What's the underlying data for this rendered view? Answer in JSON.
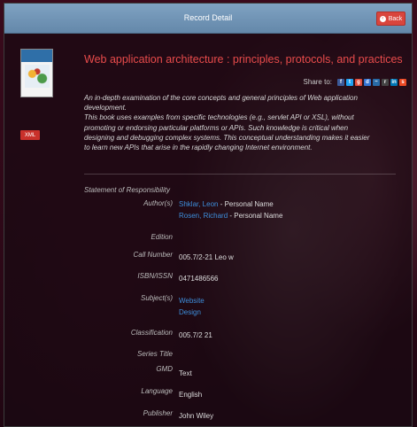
{
  "header": {
    "title": "Record Detail",
    "back_label": "Back"
  },
  "record": {
    "title": "Web application architecture : principles, protocols, and practices",
    "xml_label": "XML",
    "cover_alt": "Web Application Architecture",
    "share_label": "Share to:",
    "share_icons": [
      "facebook-icon",
      "twitter-icon",
      "google-plus-icon",
      "delicious-icon",
      "digg-icon",
      "reddit-icon",
      "linkedin-icon",
      "stumbleupon-icon"
    ],
    "description_lines": [
      "An in-depth examination of the core concepts and general principles of Web application",
      "development.",
      "This book uses examples from specific technologies (e.g., servlet API or XSL), without",
      "promoting or endorsing particular platforms or APIs. Such knowledge is critical when",
      "designing and debugging complex systems. This conceptual understanding makes it easier",
      "to learn new APIs that arise in the rapidly changing Internet environment."
    ]
  },
  "details": {
    "section_label": "Statement of Responsibility",
    "authors_label": "Author(s)",
    "authors": [
      {
        "name": "Shklar, Leon",
        "role": " - Personal Name"
      },
      {
        "name": "Rosen, Richard",
        "role": " - Personal Name"
      }
    ],
    "edition_label": "Edition",
    "edition": "",
    "call_number_label": "Call Number",
    "call_number": "005.7/2-21 Leo w",
    "isbn_label": "ISBN/ISSN",
    "isbn": "0471486566",
    "subjects_label": "Subject(s)",
    "subjects": [
      "Website",
      "Design"
    ],
    "classification_label": "Classification",
    "classification": "005.7/2 21",
    "series_label": "Series Title",
    "series": "",
    "gmd_label": "GMD",
    "gmd": "Text",
    "language_label": "Language",
    "language": "English",
    "publisher_label": "Publisher",
    "publisher": "John Wiley"
  },
  "colors": {
    "header_bg": "#6f93b6",
    "back_button": "#d9453d",
    "title": "#e84b4b",
    "link": "#3d8edb"
  }
}
